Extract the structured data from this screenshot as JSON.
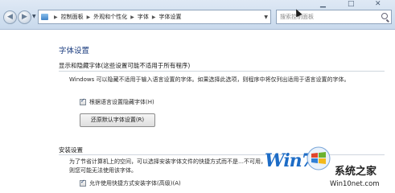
{
  "toolbar": {
    "back_icon": "back-arrow-icon",
    "forward_icon": "forward-arrow-icon",
    "breadcrumb": [
      "控制面板",
      "外观和个性化",
      "字体",
      "字体设置"
    ],
    "search_placeholder": "搜索控制面板"
  },
  "page": {
    "title": "字体设置"
  },
  "hide_fonts": {
    "title": "显示和隐藏字体(这些设置可能不适用于所有程序)",
    "description": "Windows 可以隐藏不适用于输入语言设置的字体。如果选择此选项，则程序中将仅列出适用于语言设置的字体。",
    "checkbox_label": "根据语言设置隐藏字体(H)",
    "checkbox_checked": true,
    "restore_button": "还原默认字体设置(R)"
  },
  "install": {
    "title": "安装设置",
    "description": "为了节省计算机上的空间，可以选择安装字体文件的快捷方式而不是…不可用，则您可能无法使用该字体。",
    "checkbox_label": "允许使用快捷方式安装字体(高级)(A)",
    "checkbox_checked": true
  },
  "watermark": {
    "brand": "Win7",
    "brand_cn": "系统之家",
    "url": "Win10net.com"
  },
  "colors": {
    "title_blue": "#1e3f80",
    "toolbar_bg": "#dfe9f5",
    "brand_blue": "#1d6cc6"
  }
}
